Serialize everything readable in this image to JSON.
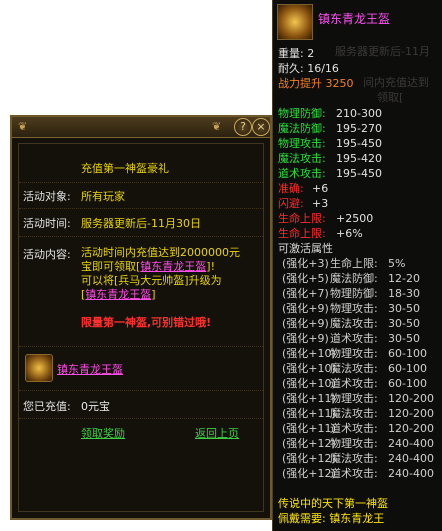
{
  "event_panel": {
    "header_help": "?",
    "header_close": "×",
    "title": "充值第一神盔豪礼",
    "target_label": "活动对象:",
    "target_value": "所有玩家",
    "time_label": "活动时间:",
    "time_value": "服务器更新后-11月30日",
    "content_label": "活动内容:",
    "content_line1": "活动时间内充值达到2000000元",
    "content_line2a": "宝即可领取[",
    "content_line2_item": "镇东青龙王盔",
    "content_line2b": "]!",
    "content_line3": "可以将[兵马大元帅盔]升级为",
    "content_line4a": "[",
    "content_line4_item": "镇东青龙王盔",
    "content_line4b": "]",
    "content_warning": "限量第一神盔,可别错过哦!",
    "reward_item_name": "镇东青龙王盔",
    "recharged_label": "您已充值:",
    "recharged_value": "0元宝",
    "claim_button": "领取奖励",
    "back_button": "返回上页"
  },
  "tooltip": {
    "item_name": "镇东青龙王盔",
    "weight_label": "重量:",
    "weight_value": "2",
    "durability_label": "耐久:",
    "durability_value": "16/16",
    "power_label": "战力提升",
    "power_value": "3250",
    "stats": [
      {
        "label": "物理防御:",
        "value": "210-300"
      },
      {
        "label": "魔法防御:",
        "value": "195-270"
      },
      {
        "label": "物理攻击:",
        "value": "195-450"
      },
      {
        "label": "魔法攻击:",
        "value": "195-420"
      },
      {
        "label": "道术攻击:",
        "value": "195-450"
      }
    ],
    "accuracy_label": "准确:",
    "accuracy_value": "+6",
    "agility_label": "闪避:",
    "agility_value": "+3",
    "hp_label": "生命上限:",
    "hp_value": "+2500",
    "hp_pct_label": "生命上限:",
    "hp_pct_value": "+6%",
    "activatable_label": "可激活属性",
    "enchants": [
      {
        "level": "(强化+3)",
        "stat": "生命上限:",
        "value": "5%"
      },
      {
        "level": "(强化+5)",
        "stat": "魔法防御:",
        "value": "12-20"
      },
      {
        "level": "(强化+7)",
        "stat": "物理防御:",
        "value": "18-30"
      },
      {
        "level": "(强化+9)",
        "stat": "物理攻击:",
        "value": "30-50"
      },
      {
        "level": "(强化+9)",
        "stat": "魔法攻击:",
        "value": "30-50"
      },
      {
        "level": "(强化+9)",
        "stat": "道术攻击:",
        "value": "30-50"
      },
      {
        "level": "(强化+10)",
        "stat": "物理攻击:",
        "value": "60-100"
      },
      {
        "level": "(强化+10)",
        "stat": "魔法攻击:",
        "value": "60-100"
      },
      {
        "level": "(强化+10)",
        "stat": "道术攻击:",
        "value": "60-100"
      },
      {
        "level": "(强化+11)",
        "stat": "物理攻击:",
        "value": "120-200"
      },
      {
        "level": "(强化+11)",
        "stat": "魔法攻击:",
        "value": "120-200"
      },
      {
        "level": "(强化+11)",
        "stat": "道术攻击:",
        "value": "120-200"
      },
      {
        "level": "(强化+12)",
        "stat": "物理攻击:",
        "value": "240-400"
      },
      {
        "level": "(强化+12)",
        "stat": "魔法攻击:",
        "value": "240-400"
      },
      {
        "level": "(强化+12)",
        "stat": "道术攻击:",
        "value": "240-400"
      }
    ],
    "footer_line1": "传说中的天下第一神盔",
    "footer_line2": "佩戴需要: 镇东青龙王",
    "faded_text_1": "服务器更新后-11月",
    "faded_text_2": "间内充值达到",
    "faded_text_3": "领取["
  }
}
